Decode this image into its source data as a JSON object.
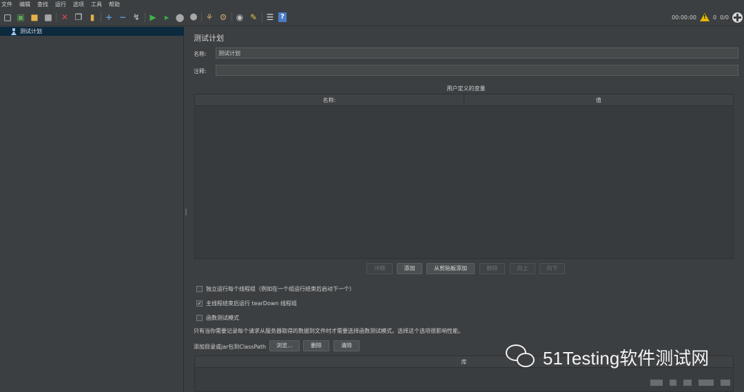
{
  "menu": [
    "文件",
    "编辑",
    "查找",
    "运行",
    "选项",
    "工具",
    "帮助"
  ],
  "toolbar_icons": [
    "new-icon",
    "templates-icon",
    "open-icon",
    "save-icon",
    "cut-icon",
    "copy-icon",
    "paste-icon",
    "expand-icon",
    "collapse-icon",
    "toggle-icon",
    "start-icon",
    "start-no-pause-icon",
    "stop-icon",
    "shutdown-icon",
    "clear-icon",
    "clear-all-icon",
    "search-icon",
    "reset-search-icon",
    "function-helper-icon",
    "help-icon"
  ],
  "status": {
    "timer": "00:00:00",
    "warnings": "0",
    "threads": "0/0"
  },
  "tree": {
    "root_label": "测试计划"
  },
  "panel": {
    "title": "测试计划",
    "name_label": "名称:",
    "name_value": "测试计划",
    "comment_label": "注释:",
    "comment_value": "",
    "vars_title": "用户定义的变量",
    "vars_columns": [
      "名称:",
      "值"
    ]
  },
  "buttons": {
    "detail": "详细",
    "add": "添加",
    "add_clipboard": "从剪贴板添加",
    "delete": "删除",
    "up": "向上",
    "down": "向下"
  },
  "options": {
    "serialize": "独立运行每个线程组（例如在一个组运行结束后启动下一个）",
    "serialize_checked": false,
    "teardown": "主线程结束后运行 tearDown 线程组",
    "teardown_checked": true,
    "functional": "函数测试模式",
    "functional_checked": false
  },
  "note": "只有当你需要记录每个请求从服务器取得的数据到文件时才需要选择函数测试模式。选择这个选项很影响性能。",
  "classpath": {
    "label": "添加目录或jar包到ClassPath",
    "browse": "浏览...",
    "delete": "删除",
    "clear": "清除",
    "lib_column": "库"
  },
  "watermark": "51Testing软件测试网",
  "colors": {
    "selection": "#0d293e",
    "background": "#3c3f41",
    "run_green": "#3fb24a"
  }
}
